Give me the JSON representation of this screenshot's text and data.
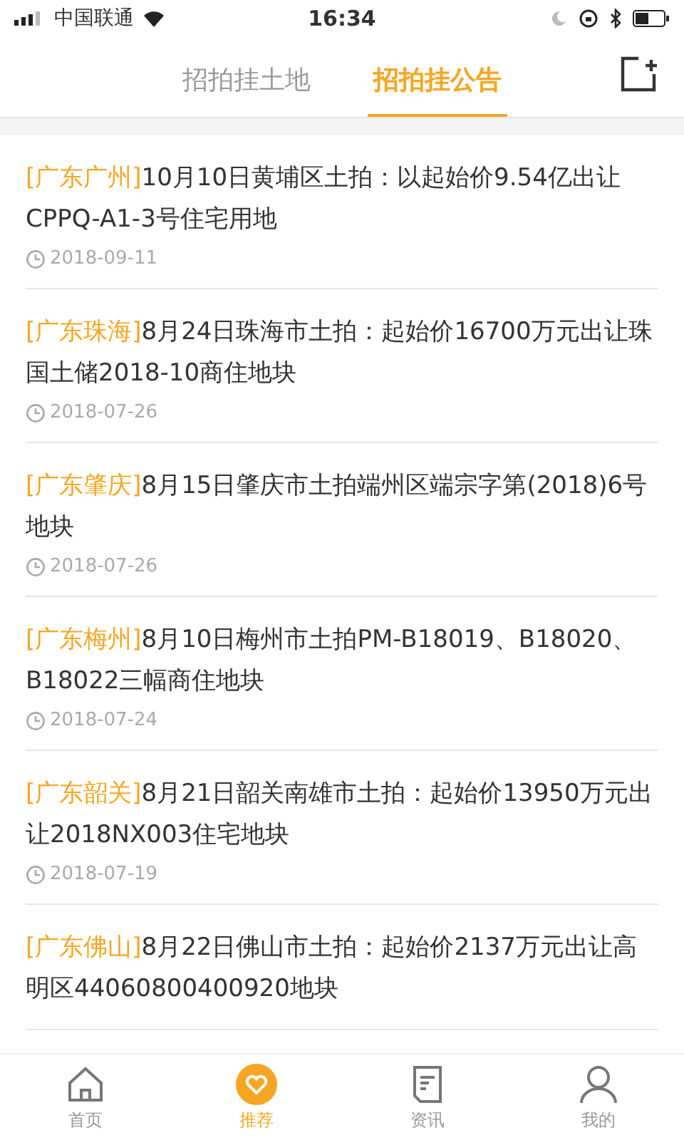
{
  "status_bar": {
    "carrier": "中国联通",
    "time": "16:34"
  },
  "tabs": [
    {
      "label": "招拍挂土地",
      "selected": false
    },
    {
      "label": "招拍挂公告",
      "selected": true
    }
  ],
  "articles": [
    {
      "region": "[广东广州]",
      "title": "10月10日黄埔区土拍：以起始价9.54亿出让CPPQ-A1-3号住宅用地",
      "date": "2018-09-11"
    },
    {
      "region": "[广东珠海]",
      "title": "8月24日珠海市土拍：起始价16700万元出让珠国土储2018-10商住地块",
      "date": "2018-07-26"
    },
    {
      "region": "[广东肇庆]",
      "title": "8月15日肇庆市土拍端州区端宗字第(2018)6号地块",
      "date": "2018-07-26"
    },
    {
      "region": "[广东梅州]",
      "title": "8月10日梅州市土拍PM-B18019、B18020、B18022三幅商住地块",
      "date": "2018-07-24"
    },
    {
      "region": "[广东韶关]",
      "title": "8月21日韶关南雄市土拍：起始价13950万元出让2018NX003住宅地块",
      "date": "2018-07-19"
    },
    {
      "region": "[广东佛山]",
      "title": "8月22日佛山市土拍：起始价2137万元出让高明区44060800400920地块"
    }
  ],
  "bottom_nav": [
    {
      "kind": "home",
      "label": "首页",
      "selected": false
    },
    {
      "kind": "recommend",
      "label": "推荐",
      "selected": true
    },
    {
      "kind": "news",
      "label": "资讯",
      "selected": false
    },
    {
      "kind": "profile",
      "label": "我的",
      "selected": false
    }
  ]
}
